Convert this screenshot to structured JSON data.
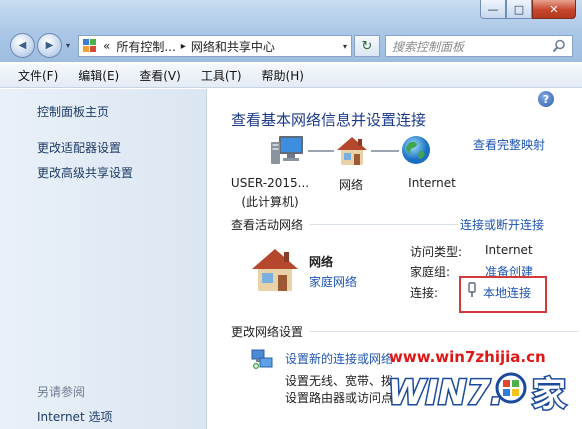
{
  "window": {
    "minimize_glyph": "—",
    "maximize_glyph": "□",
    "close_glyph": "✕"
  },
  "nav": {
    "back_glyph": "◀",
    "forward_glyph": "▶",
    "dropdown_glyph": "▾",
    "address_prefix": "«",
    "address_segments": [
      "所有控制...",
      "网络和共享中心"
    ],
    "separator": "▸",
    "refresh_glyph": "↻",
    "search_placeholder": "搜索控制面板"
  },
  "menu": [
    "文件(F)",
    "编辑(E)",
    "查看(V)",
    "工具(T)",
    "帮助(H)"
  ],
  "left_pane": {
    "links": [
      "控制面板主页",
      "更改适配器设置",
      "更改高级共享设置"
    ],
    "see_also_title": "另请参阅",
    "see_also_links": [
      "Internet 选项"
    ]
  },
  "main": {
    "help_glyph": "?",
    "heading": "查看基本网络信息并设置连接",
    "view_full_map": "查看完整映射",
    "map_nodes": [
      {
        "label": "USER-2015...",
        "sub": "(此计算机)",
        "icon": "computer-icon"
      },
      {
        "label": "网络",
        "sub": "",
        "icon": "house-icon"
      },
      {
        "label": "Internet",
        "sub": "",
        "icon": "globe-icon"
      }
    ],
    "active_networks_title": "查看活动网络",
    "connect_disconnect": "连接或断开连接",
    "network_name": "网络",
    "network_type": "家庭网络",
    "access_type_label": "访问类型:",
    "access_type_value": "Internet",
    "homegroup_label": "家庭组:",
    "homegroup_value": "准备创建",
    "connection_label": "连接:",
    "connection_value": "本地连接",
    "change_settings_title": "更改网络设置",
    "setup_link": "设置新的连接或网络",
    "setup_desc_1": "设置无线、宽带、拨",
    "setup_desc_2": "设置路由器或访问点",
    "accent_color": "#1e55b3",
    "highlight_color": "#d23b3b"
  },
  "watermark": {
    "url": "www.win7zhijia.cn",
    "brand": "WIN7.家"
  }
}
